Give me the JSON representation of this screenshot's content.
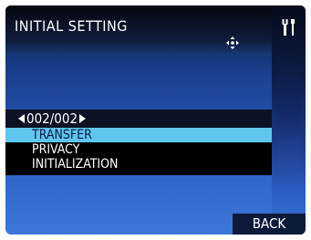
{
  "header": {
    "title": "INITIAL SETTING",
    "move_icon": "move-cross-icon",
    "tools_icon": "wrench-screwdriver-icon"
  },
  "pager": {
    "text": "002/002"
  },
  "menu": {
    "items": [
      {
        "label": "TRANSFER",
        "selected": true
      },
      {
        "label": "PRIVACY",
        "selected": false
      },
      {
        "label": "INITIALIZATION",
        "selected": false
      }
    ]
  },
  "footer": {
    "back_label": "BACK"
  },
  "colors": {
    "selection": "#5fc6ee",
    "background": "#2d62c8"
  }
}
